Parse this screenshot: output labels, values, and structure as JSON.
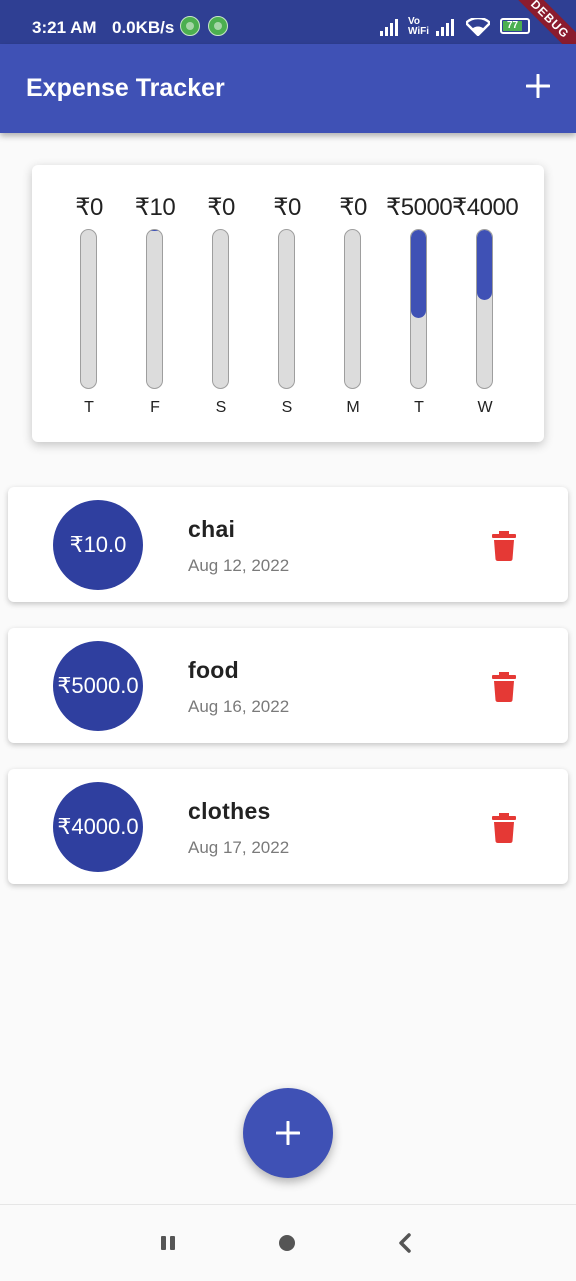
{
  "status_bar": {
    "time": "3:21 AM",
    "speed": "0.0KB/s",
    "vowifi_line1": "Vo",
    "vowifi_line2": "WiFi",
    "battery": "77",
    "debug_label": "DEBUG"
  },
  "app_bar": {
    "title": "Expense Tracker",
    "add_icon": "plus-icon"
  },
  "chart": {
    "bars": [
      {
        "amount": "₹0",
        "day": "T",
        "fill_fraction": 0
      },
      {
        "amount": "₹10",
        "day": "F",
        "fill_fraction": 0.001
      },
      {
        "amount": "₹0",
        "day": "S",
        "fill_fraction": 0
      },
      {
        "amount": "₹0",
        "day": "S",
        "fill_fraction": 0
      },
      {
        "amount": "₹0",
        "day": "M",
        "fill_fraction": 0
      },
      {
        "amount": "₹5000",
        "day": "T",
        "fill_fraction": 0.555
      },
      {
        "amount": "₹4000",
        "day": "W",
        "fill_fraction": 0.444
      }
    ],
    "bar_color": "#3f51b5"
  },
  "transactions": [
    {
      "amount": "₹10.0",
      "title": "chai",
      "date": "Aug 12, 2022"
    },
    {
      "amount": "₹5000.0",
      "title": "food",
      "date": "Aug 16, 2022"
    },
    {
      "amount": "₹4000.0",
      "title": "clothes",
      "date": "Aug 17, 2022"
    }
  ],
  "colors": {
    "primary": "#3f51b5",
    "avatar": "#2f3f9f",
    "delete": "#e53935"
  },
  "fab_icon": "plus-icon",
  "nav": [
    "recents-icon",
    "home-icon",
    "back-icon"
  ]
}
